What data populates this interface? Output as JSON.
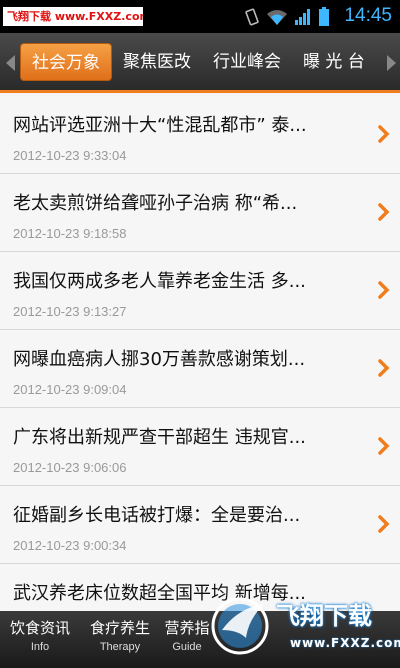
{
  "status_bar": {
    "watermark": "飞翔下载 www.FXXZ.com",
    "time": "14:45",
    "icons": [
      "vibrate-icon",
      "wifi-icon",
      "signal-icon",
      "battery-icon"
    ]
  },
  "tabs": [
    {
      "label": "社会万象",
      "active": true
    },
    {
      "label": "聚焦医改",
      "active": false
    },
    {
      "label": "行业峰会",
      "active": false
    },
    {
      "label": "曝 光 台",
      "active": false
    }
  ],
  "news": [
    {
      "title": "网站评选亚洲十大“性混乱都市” 泰...",
      "time": "2012-10-23 9:33:04"
    },
    {
      "title": "老太卖煎饼给聋哑孙子治病 称“希...",
      "time": "2012-10-23 9:18:58"
    },
    {
      "title": "我国仅两成多老人靠养老金生活 多...",
      "time": "2012-10-23 9:13:27"
    },
    {
      "title": "网曝血癌病人挪30万善款感谢策划...",
      "time": "2012-10-23 9:09:04"
    },
    {
      "title": "广东将出新规严查干部超生 违规官...",
      "time": "2012-10-23 9:06:06"
    },
    {
      "title": "征婚副乡长电话被打爆：全是要治...",
      "time": "2012-10-23 9:00:34"
    },
    {
      "title": "武汉养老床位数超全国平均 新增每...",
      "time": ""
    }
  ],
  "bottom_nav": [
    {
      "label": "饮食资讯",
      "sub": "Info"
    },
    {
      "label": "食疗养生",
      "sub": "Therapy"
    },
    {
      "label": "营养指",
      "sub": "Guide"
    }
  ],
  "watermark_br": {
    "text": "飞翔下载",
    "sub": "www.FXXZ.com"
  },
  "colors": {
    "accent": "#f07d1d",
    "clock": "#3fb7ff"
  }
}
